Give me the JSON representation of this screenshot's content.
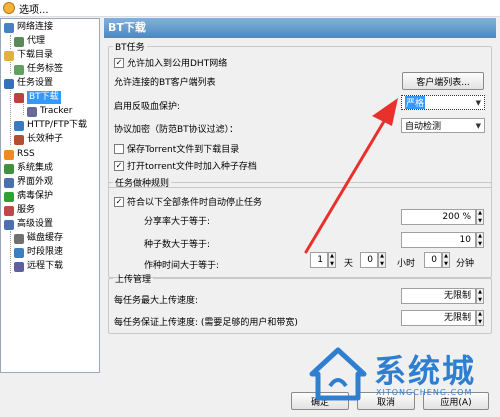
{
  "window": {
    "title": "选项..."
  },
  "tree": [
    {
      "label": "网络连接",
      "color": "#4a7fc1"
    },
    {
      "label": "代理",
      "color": "#5a8a5a"
    },
    {
      "label": "下载目录",
      "color": "#e0b040"
    },
    {
      "label": "任务标签",
      "color": "#60a060"
    },
    {
      "label": "任务设置",
      "color": "#3b6fb5"
    },
    {
      "label": "BT下载",
      "color": "#c04040"
    },
    {
      "label": "Tracker",
      "color": "#6a6a9a"
    },
    {
      "label": "HTTP/FTP下载",
      "color": "#3a7ac0"
    },
    {
      "label": "长效种子",
      "color": "#b05030"
    },
    {
      "label": "RSS",
      "color": "#f08a20"
    },
    {
      "label": "系统集成",
      "color": "#409040"
    },
    {
      "label": "界面外观",
      "color": "#4a70b0"
    },
    {
      "label": "病毒保护",
      "color": "#30a030"
    },
    {
      "label": "服务",
      "color": "#c04848"
    },
    {
      "label": "高级设置",
      "color": "#4a70b0"
    },
    {
      "label": "磁盘缓存",
      "color": "#707070"
    },
    {
      "label": "时段限速",
      "color": "#3a80c0"
    },
    {
      "label": "远程下载",
      "color": "#6060a0"
    }
  ],
  "panel": {
    "header": "BT下载",
    "bt_group": {
      "legend": "BT任务",
      "dht_label": "允许加入到公用DHT网络",
      "client_list_label": "允许连接的BT客户端列表",
      "client_list_button": "客户端列表...",
      "anti_leech_label": "启用反吸血保护:",
      "anti_leech_value": "严格",
      "encryption_label": "协议加密（防范BT协议过滤）：",
      "encryption_value": "自动检测",
      "save_torrent_label": "保存Torrent文件到下载目录",
      "open_torrent_label": "打开torrent文件时加入种子存档"
    },
    "stop_group": {
      "legend": "任务做种规则",
      "auto_stop_label": "符合以下全部条件时自动停止任务",
      "share_ratio_label": "分享率大于等于:",
      "share_ratio_value": "200 %",
      "seed_count_label": "种子数大于等于:",
      "seed_count_value": "10",
      "seed_time_label": "作种时间大于等于:",
      "days_value": "1",
      "days_unit": "天",
      "hours_value": "0",
      "hours_unit": "小时",
      "minutes_value": "0",
      "minutes_unit": "分钟"
    },
    "upload_group": {
      "legend": "上传管理",
      "max_upload_label": "每任务最大上传速度:",
      "max_upload_value": "无限制",
      "min_upload_label": "每任务保证上传速度: (需要足够的用户和带宽)",
      "min_upload_value": "无限制"
    }
  },
  "buttons": {
    "ok": "确定",
    "cancel": "取消",
    "apply": "应用(A)"
  },
  "watermark": {
    "text": "系统城",
    "sub": "XITONGCHENG.COM"
  },
  "colors": {
    "header": "#4f87bd",
    "arrow": "#e8302c",
    "watermark": "#2f7fd1"
  }
}
